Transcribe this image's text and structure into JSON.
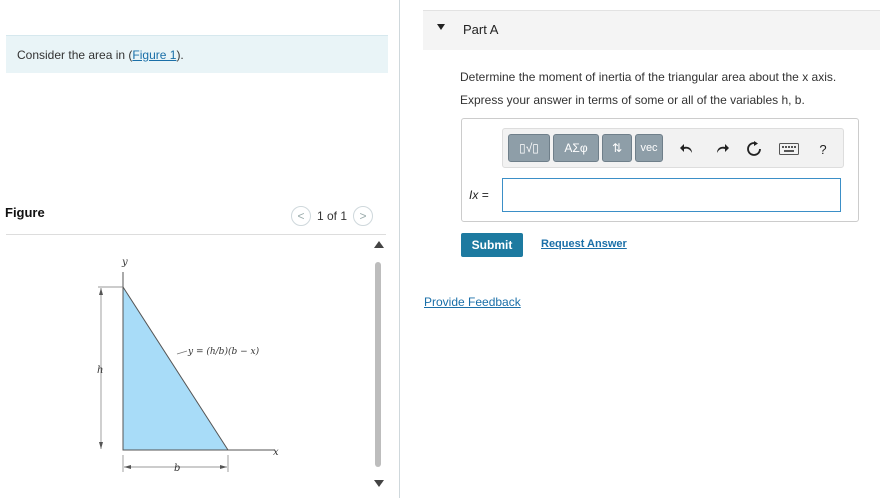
{
  "context": {
    "prefix": "Consider the area in (",
    "link": "Figure 1",
    "suffix": ")."
  },
  "figure": {
    "label": "Figure",
    "pager": {
      "current": "1 of 1",
      "prev_glyph": "<",
      "next_glyph": ">"
    },
    "diagram": {
      "fill": "#a8dcf8",
      "labels": {
        "y_axis": "y",
        "x_axis": "x",
        "height": "h",
        "base": "b",
        "curve": "y = (h/b)(b − x)"
      }
    }
  },
  "part": {
    "title": "Part A"
  },
  "question": {
    "line1": "Determine the moment of inertia of the triangular area about the x axis.",
    "line2": "Express your answer in terms of some or all of the variables h, b."
  },
  "toolbar": {
    "templates_label": "▯√▯",
    "greek_label": "ΑΣφ",
    "arrows_label": "⇅",
    "vec_label": "vec",
    "undo_icon": "undo-icon",
    "redo_icon": "redo-icon",
    "reset_icon": "reset-icon",
    "keyboard_icon": "keyboard-icon",
    "help_label": "?"
  },
  "answer": {
    "variable_label": "Ix =",
    "value": ""
  },
  "buttons": {
    "submit": "Submit",
    "request_answer": "Request Answer"
  },
  "feedback": {
    "label": "Provide Feedback"
  },
  "colors": {
    "accent": "#1d7aa0",
    "link": "#1a6fa8",
    "context_bg": "#e9f4f7"
  }
}
